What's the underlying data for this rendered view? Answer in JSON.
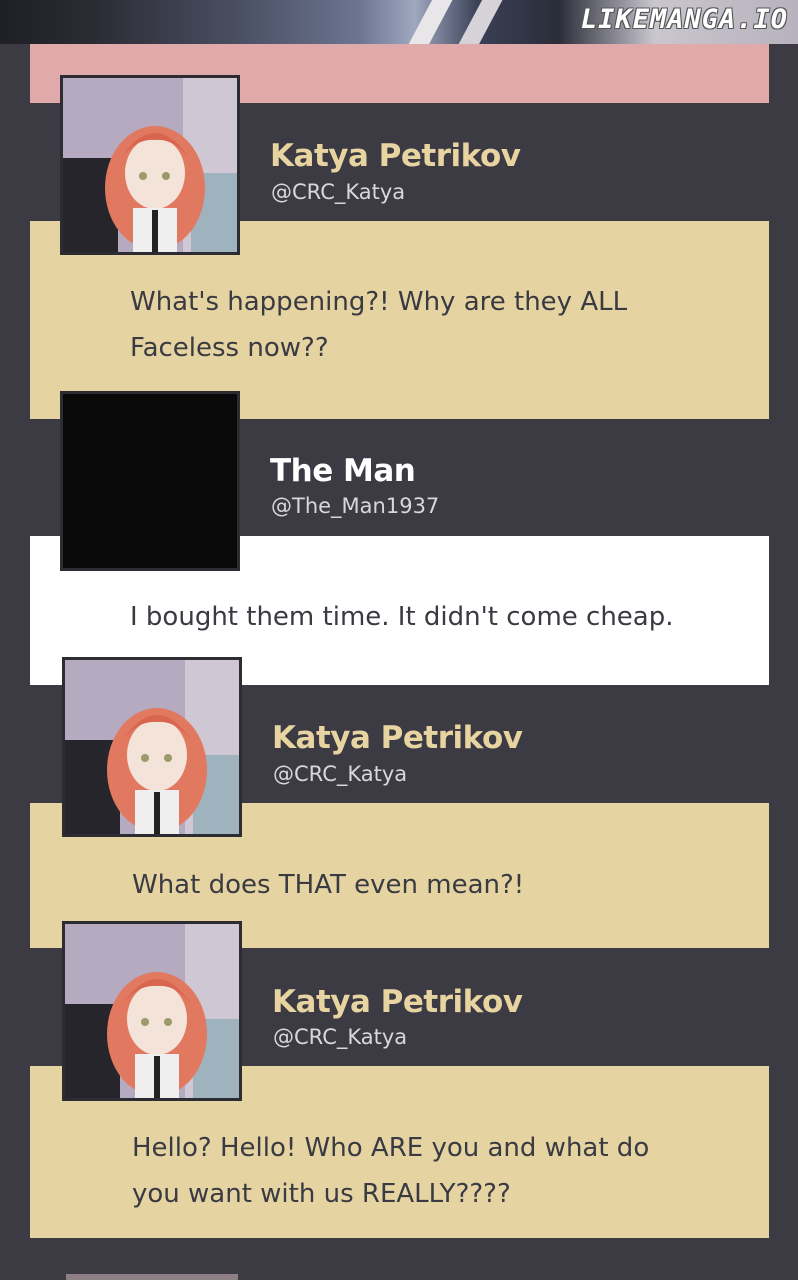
{
  "header": {
    "watermark": "LIKEMANGA.IO"
  },
  "posts": [
    {
      "name": "Katya Petrikov",
      "handle": "@CRC_Katya",
      "message": "What's happening?! Why are they ALL\nFaceless now??",
      "avatar": "katya-avatar",
      "bubble_color": "#e5d4a2"
    },
    {
      "name": "The Man",
      "handle": "@The_Man1937",
      "message": "I bought them time. It didn't come cheap.",
      "avatar": "black-avatar",
      "bubble_color": "#ffffff"
    },
    {
      "name": "Katya Petrikov",
      "handle": "@CRC_Katya",
      "message": "What does THAT even mean?!",
      "avatar": "katya-avatar",
      "bubble_color": "#e5d4a2"
    },
    {
      "name": "Katya Petrikov",
      "handle": "@CRC_Katya",
      "message": "Hello? Hello! Who ARE you and what do\nyou want with us REALLY????",
      "avatar": "katya-avatar",
      "bubble_color": "#e5d4a2"
    }
  ],
  "colors": {
    "background": "#3c3b43",
    "pink_bar": "#e0a9aa",
    "katya_name": "#e7d4a0",
    "man_name": "#ffffff"
  }
}
